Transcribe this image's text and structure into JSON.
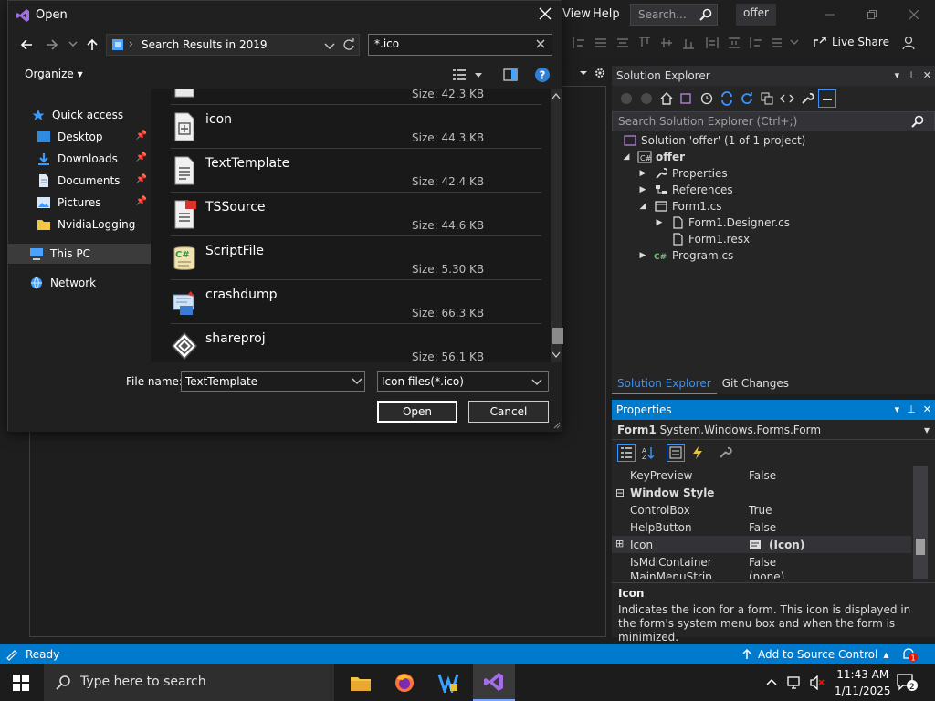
{
  "vs": {
    "menu_view": "View",
    "menu_help": "Help",
    "search_placeholder": "Search...",
    "solution_name": "offer",
    "liveshare": "Live Share"
  },
  "solution_explorer": {
    "title": "Solution Explorer",
    "search_placeholder": "Search Solution Explorer (Ctrl+;)",
    "solution": "Solution 'offer' (1 of 1 project)",
    "project": "offer",
    "items": [
      "Properties",
      "References",
      "Form1.cs",
      "Form1.Designer.cs",
      "Form1.resx",
      "Program.cs"
    ],
    "tab_se": "Solution Explorer",
    "tab_git": "Git Changes"
  },
  "properties": {
    "title": "Properties",
    "object_name": "Form1",
    "object_type": "System.Windows.Forms.Form",
    "rows": [
      {
        "name": "KeyPreview",
        "value": "False"
      },
      {
        "category": "Window Style"
      },
      {
        "name": "ControlBox",
        "value": "True"
      },
      {
        "name": "HelpButton",
        "value": "False"
      },
      {
        "name": "Icon",
        "value": "(Icon)"
      },
      {
        "name": "IsMdiContainer",
        "value": "False"
      },
      {
        "name": "MainMenuStrip",
        "value": "(none)"
      }
    ],
    "desc_title": "Icon",
    "desc_text": "Indicates the icon for a form. This icon is displayed in the form's system menu box and when the form is minimized."
  },
  "status": {
    "ready": "Ready",
    "source_control": "Add to Source Control",
    "notif_count": "1"
  },
  "taskbar": {
    "search_placeholder": "Type here to search",
    "time": "11:43 AM",
    "date": "1/11/2025",
    "notif_count": "2"
  },
  "dialog": {
    "title": "Open",
    "address": "Search Results in 2019",
    "search_value": "*.ico",
    "organize": "Organize",
    "nav": {
      "quick_access": "Quick access",
      "desktop": "Desktop",
      "downloads": "Downloads",
      "documents": "Documents",
      "pictures": "Pictures",
      "nvidia": "NvidiaLogging",
      "this_pc": "This PC",
      "network": "Network"
    },
    "files": [
      {
        "name": "",
        "size": "Size: 42.3 KB"
      },
      {
        "name": "icon",
        "size": "Size: 44.3 KB"
      },
      {
        "name": "TextTemplate",
        "size": "Size: 42.4 KB"
      },
      {
        "name": "TSSource",
        "size": "Size: 44.6 KB"
      },
      {
        "name": "ScriptFile",
        "size": "Size: 5.30 KB"
      },
      {
        "name": "crashdump",
        "size": "Size: 66.3 KB"
      },
      {
        "name": "shareproj",
        "size": "Size: 56.1 KB"
      }
    ],
    "filename_label": "File name:",
    "filename_value": "TextTemplate",
    "filetype": "Icon files(*.ico)",
    "open_label": "Open",
    "cancel_label": "Cancel"
  },
  "colors": {
    "accent": "#007acc",
    "dialog_bg": "#202020",
    "vs_bg": "#1e1e1e"
  }
}
